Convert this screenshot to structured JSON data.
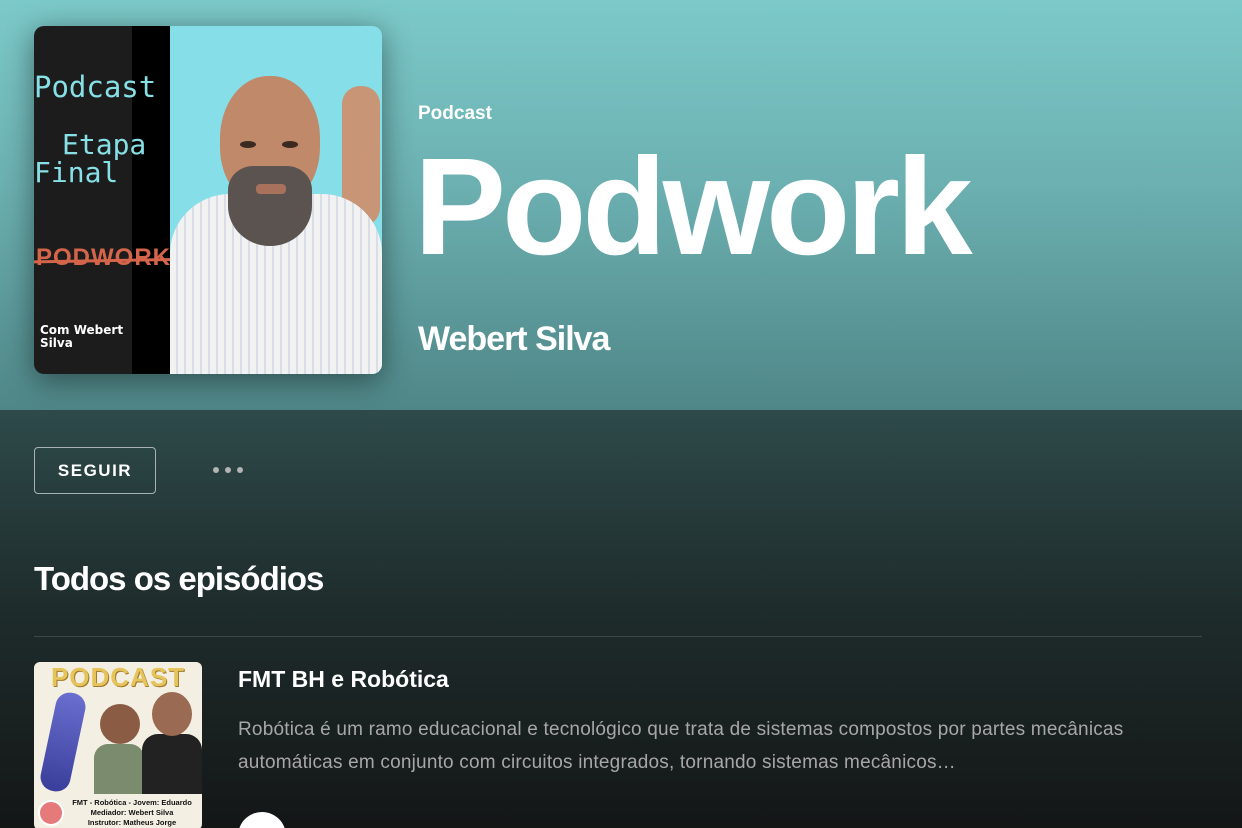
{
  "podcast": {
    "type_label": "Podcast",
    "title": "Podwork",
    "author": "Webert Silva",
    "cover": {
      "line1": "Podcast",
      "line2": "Etapa",
      "line3": "Final",
      "brand": "PODWORK",
      "credit_line1": "Com Webert",
      "credit_line2": "Silva"
    }
  },
  "actions": {
    "follow_label": "SEGUIR",
    "more_icon": "more-horizontal-icon"
  },
  "episodes_section": {
    "title": "Todos os episódios",
    "episodes": [
      {
        "title": "FMT BH e Robótica",
        "description": "Robótica é um ramo educacional e tecnológico que trata de sistemas compostos por partes mecânicas automáticas em conjunto com circuitos integrados, tornando sistemas mecânicos…",
        "thumb_title": "PODCAST",
        "thumb_caption_1": "FMT - Robótica - Jovem: Eduardo",
        "thumb_caption_2": "Mediador: Webert Silva",
        "thumb_caption_3": "Instrutor: Matheus Jorge",
        "play_icon": "play-icon"
      }
    ]
  },
  "colors": {
    "header_top": "#7cc9c9",
    "header_bottom": "#4f8687",
    "brand_red": "#d5654a",
    "muted_text": "#a7a7a7"
  }
}
